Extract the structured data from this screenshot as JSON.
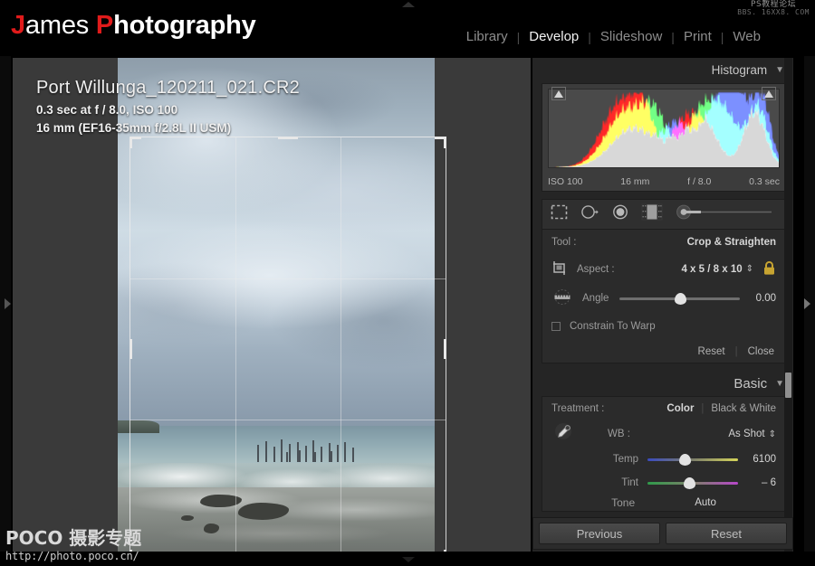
{
  "watermarks": {
    "top_right_line1": "PS教程论坛",
    "top_right_line2": "BBS. 16XX8. COM",
    "bottom_left_line1": "POCO 摄影专题",
    "bottom_left_line2": "http://photo.poco.cn/"
  },
  "header": {
    "logo": {
      "word1_initial": "J",
      "word1_rest": "ames",
      "word2_initial": "P",
      "word2_rest": "hotography"
    },
    "nav": [
      {
        "label": "Library",
        "active": false
      },
      {
        "label": "Develop",
        "active": true
      },
      {
        "label": "Slideshow",
        "active": false
      },
      {
        "label": "Print",
        "active": false
      },
      {
        "label": "Web",
        "active": false
      }
    ],
    "nav_separator": "|"
  },
  "photo_info": {
    "filename": "Port Willunga_120211_021.CR2",
    "exposure_line": "0.3 sec at f / 8.0, ISO 100",
    "lens_line": "16 mm (EF16-35mm f/2.8L II USM)"
  },
  "histogram": {
    "title": "Histogram",
    "caret": "▼",
    "iso": "ISO 100",
    "focal": "16 mm",
    "aperture": "f / 8.0",
    "shutter": "0.3 sec"
  },
  "tool_strip": {
    "icons": [
      "crop-overlay-icon",
      "spot-removal-icon",
      "red-eye-icon",
      "graduated-filter-icon",
      "adjustment-brush-icon"
    ]
  },
  "crop_panel": {
    "tool_label": "Tool :",
    "tool_value": "Crop & Straighten",
    "aspect_label": "Aspect :",
    "aspect_value": "4 x 5 / 8 x 10",
    "aspect_stepper": "⇕",
    "lock_state": "locked",
    "lock_color": "#c7a431",
    "angle_label": "Angle",
    "angle_value": "0.00",
    "angle_position_pct": 50,
    "constrain_label": "Constrain To Warp",
    "constrain_checked": false,
    "reset_label": "Reset",
    "close_label": "Close",
    "separator": "|"
  },
  "basic_panel": {
    "title": "Basic",
    "caret": "▼",
    "treatment_label": "Treatment :",
    "treatment_options": [
      {
        "label": "Color",
        "active": true
      },
      {
        "label": "Black & White",
        "active": false
      }
    ],
    "treatment_separator": "|",
    "wb_label": "WB :",
    "wb_value": "As Shot",
    "wb_stepper": "⇕",
    "temp_label": "Temp",
    "temp_value": "6100",
    "temp_position_pct": 41,
    "tint_label": "Tint",
    "tint_value": "– 6",
    "tint_position_pct": 46,
    "tone_label": "Tone",
    "auto_label": "Auto"
  },
  "bottom_bar": {
    "previous_label": "Previous",
    "reset_label": "Reset"
  },
  "colors": {
    "accent_red": "#e01b1b",
    "panel_bg": "#252525",
    "stage_bg": "#3a3a3a",
    "lock_gold": "#c7a431"
  }
}
